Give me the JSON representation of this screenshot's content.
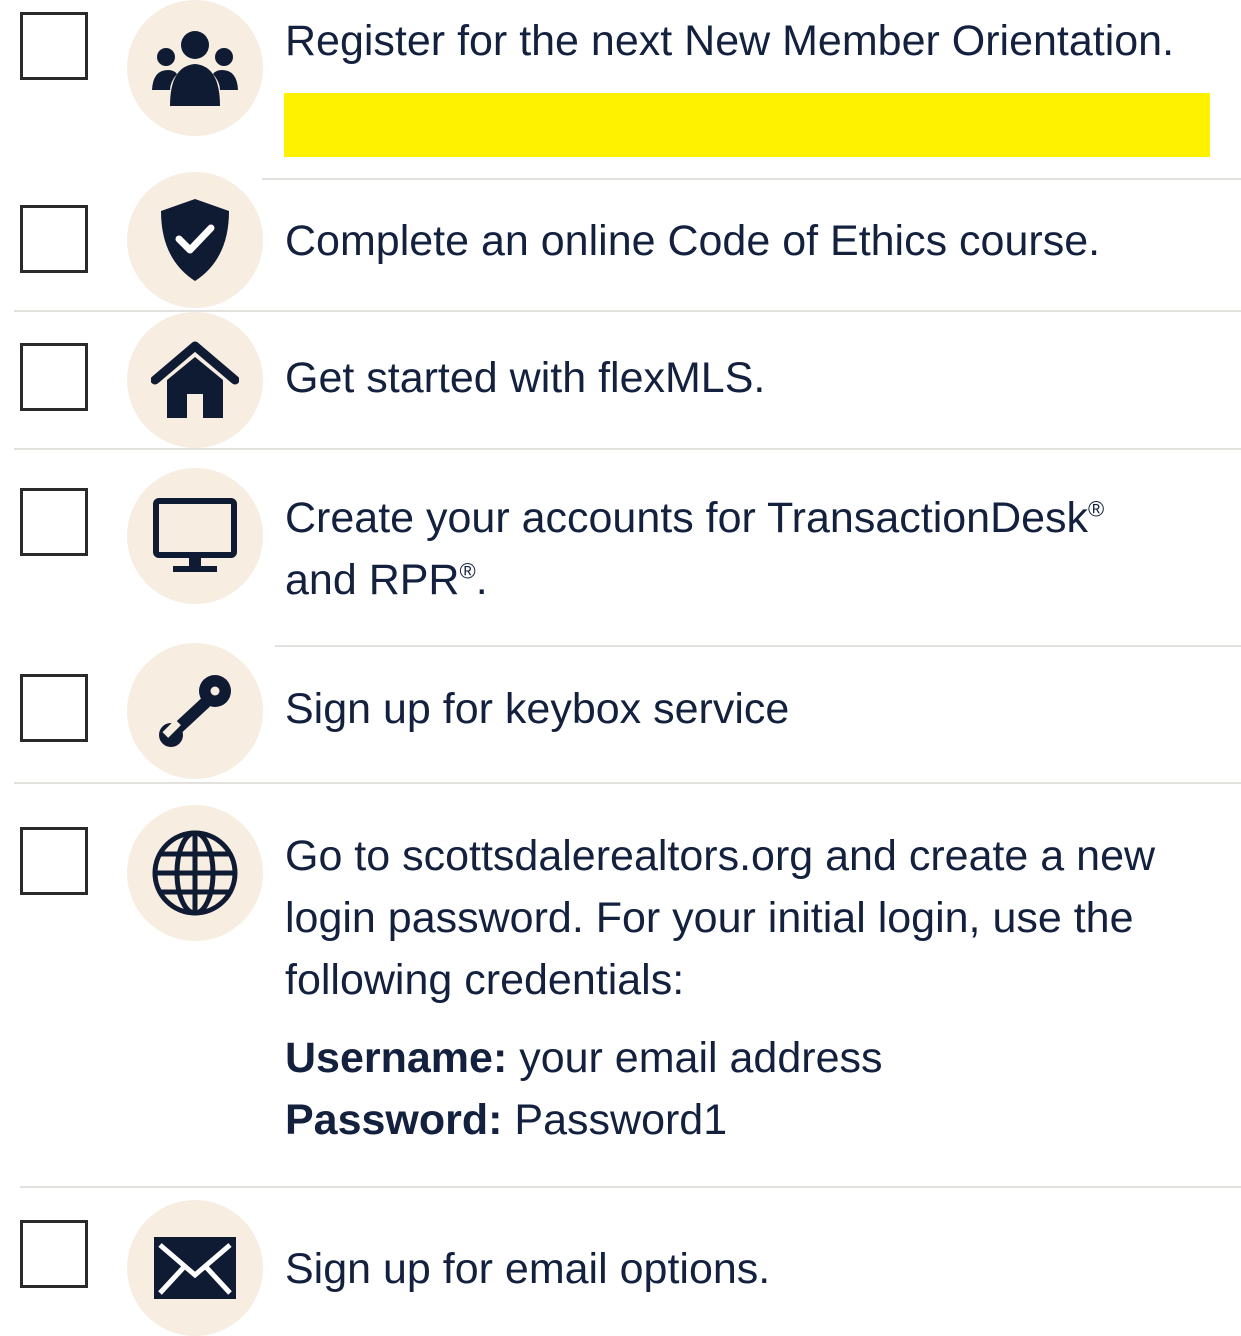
{
  "checklist": {
    "items": [
      {
        "icon": "people-group-icon",
        "text": "Register for the next New Member Orientation."
      },
      {
        "icon": "shield-check-icon",
        "text": "Complete an online Code of Ethics course."
      },
      {
        "icon": "house-icon",
        "text": "Get started with flexMLS."
      },
      {
        "icon": "monitor-icon",
        "text_line1": "Create your accounts for TransactionDesk",
        "reg1": "®",
        "text_line2": "and RPR",
        "reg2": "®",
        "text_end": "."
      },
      {
        "icon": "key-icon",
        "text": "Sign up for keybox service"
      },
      {
        "icon": "globe-icon",
        "text": "Go to scottsdalerealtors.org and create a new login password. For your initial login, use the following credentials:",
        "username_label": "Username:",
        "username_value": " your email address",
        "password_label": "Password:",
        "password_value": " Password1"
      },
      {
        "icon": "envelope-icon",
        "text": "Sign up for email options."
      }
    ]
  },
  "colors": {
    "text": "#13213f",
    "icon": "#0f1a33",
    "icon_bg": "#f7ede1",
    "highlight": "#fff200",
    "divider": "#e3e1de"
  }
}
